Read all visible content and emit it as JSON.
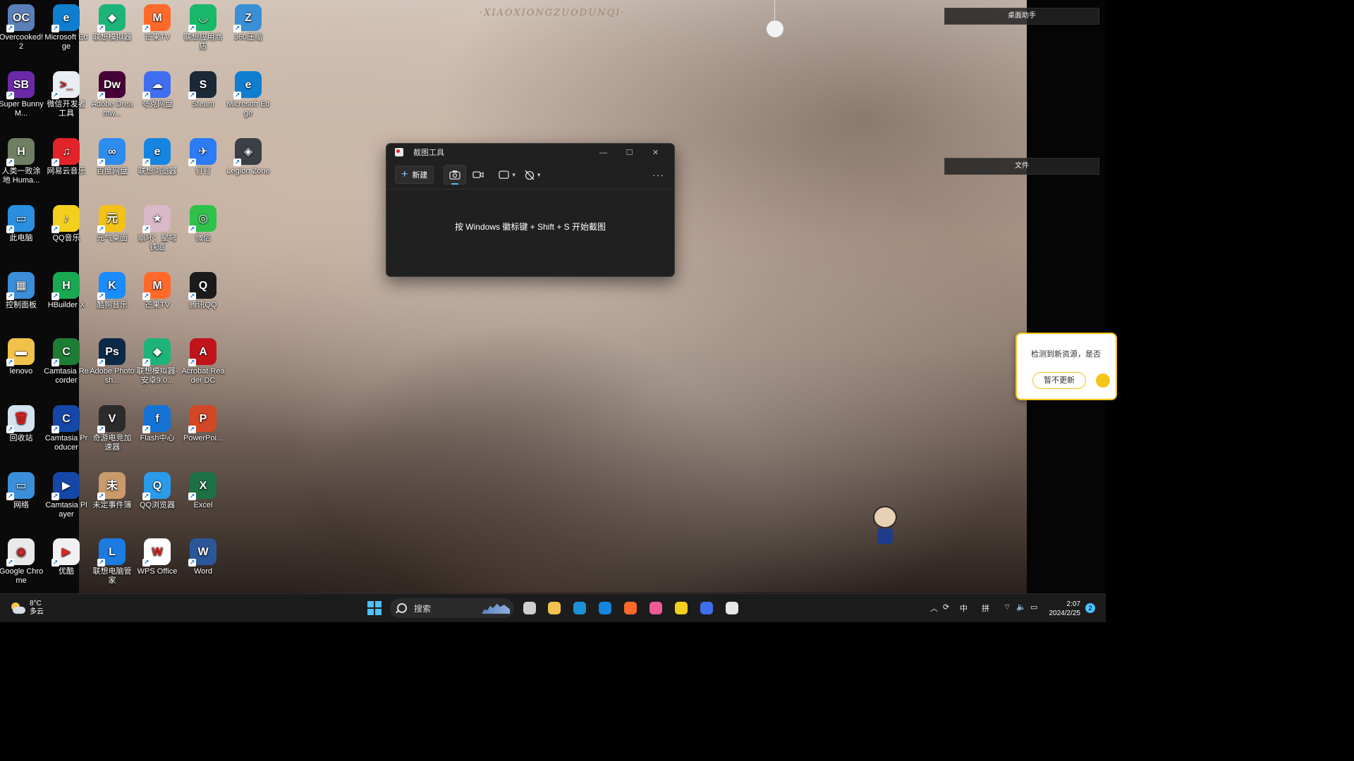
{
  "wallpaper": {
    "watermark": "·XIAOXIONGZUODUNQI·"
  },
  "desktop_icons": [
    {
      "label": "Overcooked! 2",
      "color": "#5b7fb8",
      "glyph": "OC"
    },
    {
      "label": "Microsoft Edge",
      "color": "#0f7ecf",
      "glyph": "e"
    },
    {
      "label": "联想模拟器",
      "color": "#1db47a",
      "glyph": "◆"
    },
    {
      "label": "芒果TV",
      "color": "#ff6a2b",
      "glyph": "M"
    },
    {
      "label": "联想应用商店",
      "color": "#19b86a",
      "glyph": "◡"
    },
    {
      "label": "360压缩",
      "color": "#3b8fd6",
      "glyph": "Z"
    },
    {
      "label": "Super Bunny M...",
      "color": "#6a2aa8",
      "glyph": "SB"
    },
    {
      "label": "微信开发者工具",
      "color": "#e9eef2",
      "glyph": ">_"
    },
    {
      "label": "Adobe Dreamw...",
      "color": "#470137",
      "glyph": "Dw"
    },
    {
      "label": "夸克网盘",
      "color": "#3f6ef0",
      "glyph": "☁"
    },
    {
      "label": "Steam",
      "color": "#1b2838",
      "glyph": "S"
    },
    {
      "label": "Microsoft Edge",
      "color": "#0f7ecf",
      "glyph": "e"
    },
    {
      "label": "人类一败涂地 Huma...",
      "color": "#6f7f63",
      "glyph": "H"
    },
    {
      "label": "网易云音乐",
      "color": "#e2232a",
      "glyph": "♫"
    },
    {
      "label": "百度网盘",
      "color": "#2d8cf0",
      "glyph": "∞"
    },
    {
      "label": "联想浏览器",
      "color": "#1485e0",
      "glyph": "e"
    },
    {
      "label": "钉钉",
      "color": "#2b7cf6",
      "glyph": "✈"
    },
    {
      "label": "Legion Zone",
      "color": "#3a3f48",
      "glyph": "◈"
    },
    {
      "label": "此电脑",
      "color": "#2a8fe0",
      "glyph": "▭"
    },
    {
      "label": "QQ音乐",
      "color": "#f3d01e",
      "glyph": "♪"
    },
    {
      "label": "元气桌面",
      "color": "#f2c218",
      "glyph": "元"
    },
    {
      "label": "崩坏：星穹铁道",
      "color": "#d9b8c8",
      "glyph": "★"
    },
    {
      "label": "微信",
      "color": "#2ec24b",
      "glyph": "◎"
    },
    {
      "label": "",
      "color": "",
      "glyph": ""
    },
    {
      "label": "控制面板",
      "color": "#3b8ed8",
      "glyph": "▦"
    },
    {
      "label": "HBuilder X",
      "color": "#18a952",
      "glyph": "H"
    },
    {
      "label": "酷狗音乐",
      "color": "#1a8cff",
      "glyph": "K"
    },
    {
      "label": "芒果TV",
      "color": "#ff6a2b",
      "glyph": "M"
    },
    {
      "label": "腾讯QQ",
      "color": "#1b1b1b",
      "glyph": "Q"
    },
    {
      "label": "",
      "color": "",
      "glyph": ""
    },
    {
      "label": "lenovo",
      "color": "#f1c24a",
      "glyph": "▬"
    },
    {
      "label": "Camtasia Recorder",
      "color": "#1e7d34",
      "glyph": "C"
    },
    {
      "label": "Adobe Photosh...",
      "color": "#0a2a47",
      "glyph": "Ps"
    },
    {
      "label": "联想模拟器-安卓9.0...",
      "color": "#1db47a",
      "glyph": "◆"
    },
    {
      "label": "Acrobat Reader DC",
      "color": "#c0141a",
      "glyph": "A"
    },
    {
      "label": "",
      "color": "",
      "glyph": ""
    },
    {
      "label": "回收站",
      "color": "#d4e4ef",
      "glyph": "🗑"
    },
    {
      "label": "Camtasia Producer",
      "color": "#1447a8",
      "glyph": "C"
    },
    {
      "label": "奇游电竞加速器",
      "color": "#2b2b2b",
      "glyph": "V"
    },
    {
      "label": "Flash中心",
      "color": "#1673d6",
      "glyph": "f"
    },
    {
      "label": "PowerPoi...",
      "color": "#d24726",
      "glyph": "P"
    },
    {
      "label": "",
      "color": "",
      "glyph": ""
    },
    {
      "label": "网络",
      "color": "#3a8fd8",
      "glyph": "▭"
    },
    {
      "label": "Camtasia Player",
      "color": "#1547a8",
      "glyph": "▶"
    },
    {
      "label": "未定事件簿",
      "color": "#c89a6c",
      "glyph": "未"
    },
    {
      "label": "QQ浏览器",
      "color": "#2a9be8",
      "glyph": "Q"
    },
    {
      "label": "Excel",
      "color": "#1d7044",
      "glyph": "X"
    },
    {
      "label": "",
      "color": "",
      "glyph": ""
    },
    {
      "label": "Google Chrome",
      "color": "#e9e9e9",
      "glyph": "◉"
    },
    {
      "label": "优酷",
      "color": "#f1f1f1",
      "glyph": "▶"
    },
    {
      "label": "联想电脑管家",
      "color": "#1b7be0",
      "glyph": "L"
    },
    {
      "label": "WPS Office",
      "color": "#ffffff",
      "glyph": "W"
    },
    {
      "label": "Word",
      "color": "#2b579a",
      "glyph": "W"
    },
    {
      "label": "",
      "color": "",
      "glyph": ""
    }
  ],
  "side_panels": {
    "top": "桌面助手",
    "middle": "文件"
  },
  "snipping_tool": {
    "title": "截图工具",
    "new_label": "新建",
    "more": "···",
    "hint": "按 Windows 徽标键 + Shift + S 开始截图"
  },
  "notification": {
    "text": "检测到新资源，是否",
    "dismiss_label": "暂不更新"
  },
  "taskbar": {
    "weather_temp": "8°C",
    "weather_desc": "多云",
    "search_placeholder": "搜索",
    "ime_lang": "中",
    "ime_mode": "拼",
    "time": "2:07",
    "date": "2024/2/25",
    "notif_count": "2",
    "pinned": [
      {
        "name": "task-view",
        "color": "#cfcfcf"
      },
      {
        "name": "file-explorer",
        "color": "#f2c14e"
      },
      {
        "name": "edge",
        "color": "#1e90d6"
      },
      {
        "name": "lenovo-browser",
        "color": "#1485e0"
      },
      {
        "name": "mango-tv",
        "color": "#ff6a2b"
      },
      {
        "name": "youku",
        "color": "#f15a9a"
      },
      {
        "name": "qq-music",
        "color": "#f3d01e"
      },
      {
        "name": "quark-pan",
        "color": "#3f6ef0"
      },
      {
        "name": "snipping-tool",
        "color": "#e8e8e8"
      }
    ]
  }
}
